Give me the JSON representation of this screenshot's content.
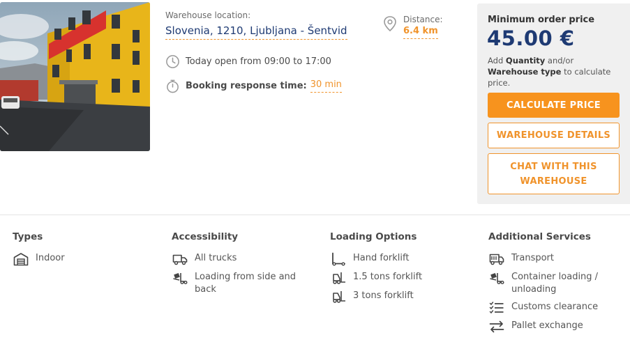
{
  "listing": {
    "location_label": "Warehouse location:",
    "location_value": "Slovenia, 1210, Ljubljana - Šentvid",
    "distance_label": "Distance:",
    "distance_value": "6.4 km",
    "hours_text": "Today open from 09:00 to 17:00",
    "booking_label": "Booking response time:",
    "booking_value": "30 min",
    "photo_icon": "warehouse-photo"
  },
  "price_panel": {
    "title": "Minimum order price",
    "price": "45.00 €",
    "hint_prefix": "Add ",
    "hint_quantity": "Quantity",
    "hint_mid": " and/or ",
    "hint_type": "Warehouse type",
    "hint_suffix": " to calculate price.",
    "calculate_label": "CALCULATE PRICE",
    "details_label": "WAREHOUSE DETAILS",
    "chat_label": "CHAT WITH THIS WAREHOUSE"
  },
  "features": {
    "types": {
      "title": "Types",
      "items": [
        {
          "icon": "warehouse-icon",
          "label": "Indoor"
        }
      ]
    },
    "accessibility": {
      "title": "Accessibility",
      "items": [
        {
          "icon": "truck-icon",
          "label": "All trucks"
        },
        {
          "icon": "loading-icon",
          "label": "Loading from side and back"
        }
      ]
    },
    "loading": {
      "title": "Loading Options",
      "items": [
        {
          "icon": "hand-forklift-icon",
          "label": "Hand forklift"
        },
        {
          "icon": "forklift-icon",
          "label": "1.5 tons forklift"
        },
        {
          "icon": "forklift-icon",
          "label": "3 tons forklift"
        }
      ]
    },
    "additional": {
      "title": "Additional Services",
      "items": [
        {
          "icon": "transport-icon",
          "label": "Transport"
        },
        {
          "icon": "container-loading-icon",
          "label": "Container loading / unloading"
        },
        {
          "icon": "checklist-icon",
          "label": "Customs clearance"
        },
        {
          "icon": "exchange-icon",
          "label": "Pallet exchange"
        }
      ]
    }
  },
  "colors": {
    "accent": "#f7931e",
    "navy": "#1e3a73",
    "panel_bg": "#f0f0f0"
  }
}
